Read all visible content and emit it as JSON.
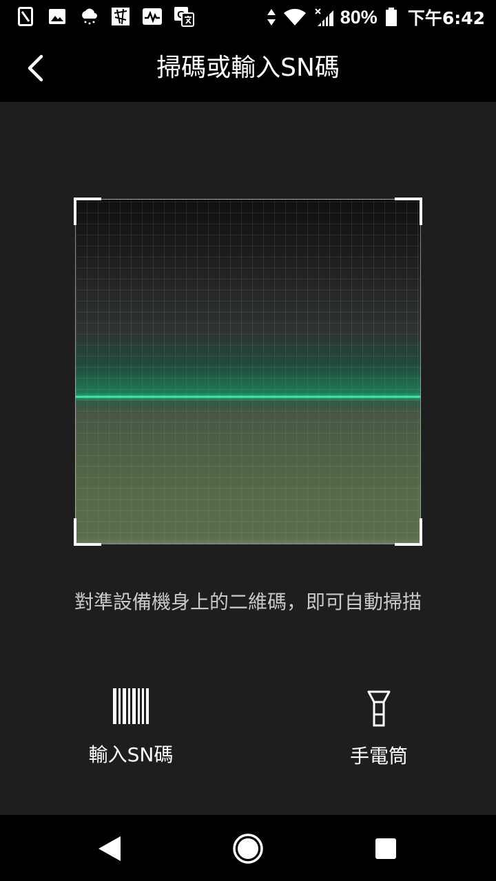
{
  "status_bar": {
    "battery": "80%",
    "time": "下午6:42",
    "left_icons": [
      "sim-icon",
      "gallery-icon",
      "weather-icon",
      "puzzle-icon",
      "pulse-icon",
      "translate-icon"
    ],
    "right_icons": [
      "data-arrows-icon",
      "wifi-icon",
      "signal-icon",
      "battery-icon"
    ]
  },
  "app_bar": {
    "title": "掃碼或輸入SN碼",
    "back_icon": "chevron-left-icon"
  },
  "scanner": {
    "hint": "對準設備機身上的二維碼，即可自動掃描",
    "line_color": "#3fe39b"
  },
  "actions": {
    "input_sn": {
      "label": "輸入SN碼",
      "icon": "barcode-icon"
    },
    "flashlight": {
      "label": "手電筒",
      "icon": "flashlight-icon"
    }
  },
  "nav_bar": {
    "back_icon": "nav-back-icon",
    "home_icon": "nav-home-icon",
    "recents_icon": "nav-recents-icon"
  },
  "colors": {
    "background": "#1f1e1f",
    "bars": "#000000",
    "accent": "#3fe39b"
  }
}
